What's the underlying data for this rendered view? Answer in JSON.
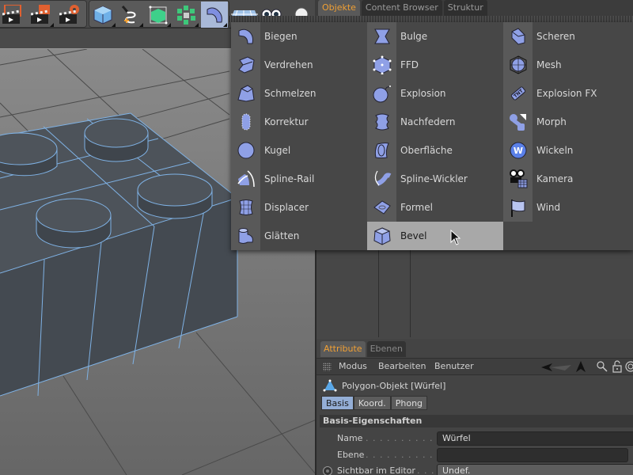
{
  "toolbar": {
    "buttons": [
      {
        "name": "render-view-icon"
      },
      {
        "name": "render-to-picture-viewer-icon"
      },
      {
        "name": "render-settings-icon"
      },
      {
        "name": "cube-primitive-icon"
      },
      {
        "name": "spline-pen-icon"
      },
      {
        "name": "generator-icon"
      },
      {
        "name": "array-icon"
      },
      {
        "name": "deformer-bend-icon",
        "active": true
      },
      {
        "name": "floor-icon"
      },
      {
        "name": "camera-eyes-icon"
      },
      {
        "name": "light-icon"
      }
    ]
  },
  "top_tabs": [
    {
      "label": "Objekte",
      "active": true
    },
    {
      "label": "Content Browser",
      "active": false
    },
    {
      "label": "Struktur",
      "active": false
    }
  ],
  "dropdown": {
    "columns": [
      [
        {
          "label": "Biegen",
          "icon": "bend-icon"
        },
        {
          "label": "Verdrehen",
          "icon": "twist-icon"
        },
        {
          "label": "Schmelzen",
          "icon": "melt-icon"
        },
        {
          "label": "Korrektur",
          "icon": "correction-icon"
        },
        {
          "label": "Kugel",
          "icon": "sphere-icon"
        },
        {
          "label": "Spline-Rail",
          "icon": "spline-rail-icon"
        },
        {
          "label": "Displacer",
          "icon": "displacer-icon"
        },
        {
          "label": "Glätten",
          "icon": "smoothing-icon"
        }
      ],
      [
        {
          "label": "Bulge",
          "icon": "bulge-icon"
        },
        {
          "label": "FFD",
          "icon": "ffd-icon"
        },
        {
          "label": "Explosion",
          "icon": "explosion-bomb-icon"
        },
        {
          "label": "Nachfedern",
          "icon": "jiggle-icon"
        },
        {
          "label": "Oberfläche",
          "icon": "surface-icon"
        },
        {
          "label": "Spline-Wickler",
          "icon": "spline-wrap-icon"
        },
        {
          "label": "Formel",
          "icon": "formula-icon"
        },
        {
          "label": "Bevel",
          "icon": "bevel-icon",
          "highlighted": true
        }
      ],
      [
        {
          "label": "Scheren",
          "icon": "shear-icon"
        },
        {
          "label": "Mesh",
          "icon": "mesh-icon"
        },
        {
          "label": "Explosion FX",
          "icon": "tnt-icon"
        },
        {
          "label": "Morph",
          "icon": "morph-icon"
        },
        {
          "label": "Wickeln",
          "icon": "wrap-icon"
        },
        {
          "label": "Kamera",
          "icon": "camera-icon"
        },
        {
          "label": "Wind",
          "icon": "wind-flag-icon"
        }
      ]
    ]
  },
  "attributes": {
    "tabs": [
      {
        "label": "Attribute",
        "active": true
      },
      {
        "label": "Ebenen",
        "active": false
      }
    ],
    "menu": [
      "Modus",
      "Bearbeiten",
      "Benutzer"
    ],
    "object_title": "Polygon-Objekt [Würfel]",
    "subtabs": [
      {
        "label": "Basis",
        "active": true
      },
      {
        "label": "Koord.",
        "active": false
      },
      {
        "label": "Phong",
        "active": false
      }
    ],
    "section_title": "Basis-Eigenschaften",
    "properties": [
      {
        "label": "Name",
        "dots": ". . . . . . . . . . . . . .",
        "value": "Würfel"
      },
      {
        "label": "Ebene",
        "dots": ". . . . . . . . . . . . . .",
        "value": ""
      },
      {
        "label": "Sichtbar im Editor",
        "dots": ". . . .",
        "value": "Undef."
      }
    ]
  },
  "colors": {
    "accent": "#f0a035",
    "selection_blue": "#94aed6",
    "wire": "#7fb2e5"
  }
}
